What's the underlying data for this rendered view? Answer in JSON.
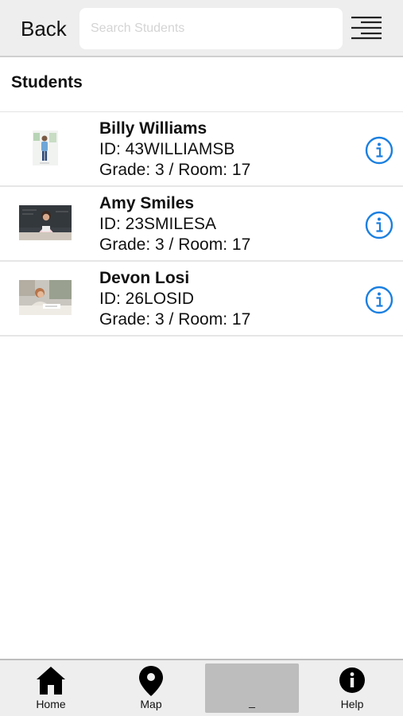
{
  "header": {
    "back_label": "Back",
    "search_placeholder": "Search Students"
  },
  "section": {
    "title": "Students"
  },
  "students": [
    {
      "name": "Billy Williams",
      "id_line": "ID: 43WILLIAMSB",
      "grade_line": "Grade: 3 / Room: 17"
    },
    {
      "name": "Amy Smiles",
      "id_line": "ID: 23SMILESA",
      "grade_line": "Grade: 3 / Room: 17"
    },
    {
      "name": "Devon Losi",
      "id_line": "ID: 26LOSID",
      "grade_line": "Grade: 3 / Room: 17"
    }
  ],
  "tabs": {
    "home": "Home",
    "map": "Map",
    "blank": "_",
    "help": "Help"
  },
  "colors": {
    "accent": "#1a7fe0",
    "bar_bg": "#eeeeee",
    "selected_tab": "#bdbdbd"
  },
  "icons": {
    "menu": "menu-icon",
    "info": "info-icon",
    "home": "home-icon",
    "map": "map-pin-icon",
    "help": "help-icon"
  }
}
